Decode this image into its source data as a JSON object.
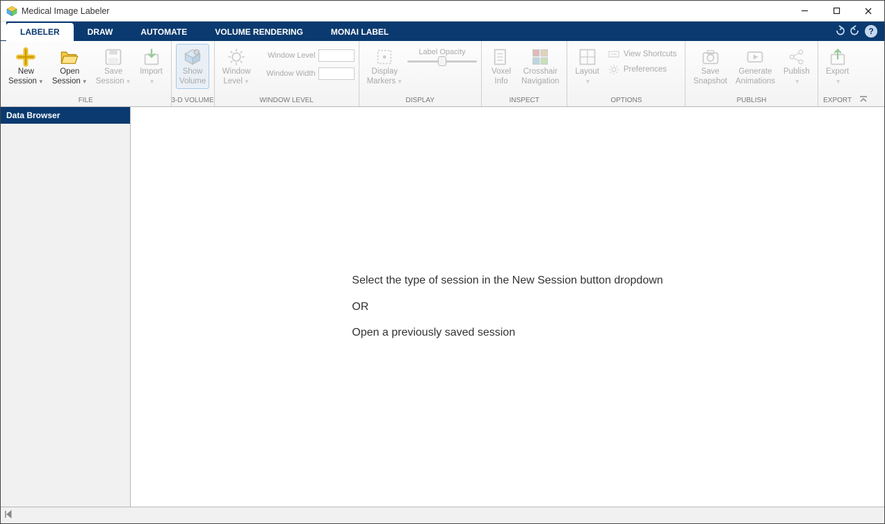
{
  "window_title": "Medical Image Labeler",
  "tabs": [
    {
      "label": "LABELER",
      "active": true
    },
    {
      "label": "DRAW",
      "active": false
    },
    {
      "label": "AUTOMATE",
      "active": false
    },
    {
      "label": "VOLUME RENDERING",
      "active": false
    },
    {
      "label": "MONAI LABEL",
      "active": false
    }
  ],
  "ribbon_groups": {
    "file": {
      "label": "FILE",
      "new_session": "New\nSession",
      "open_session": "Open\nSession",
      "save_session": "Save\nSession",
      "import": "Import"
    },
    "volume3d": {
      "label": "3-D VOLUME",
      "show_volume": "Show\nVolume"
    },
    "window_level": {
      "label": "WINDOW LEVEL",
      "window_level_btn": "Window\nLevel",
      "field_level": "Window Level",
      "field_width": "Window Width"
    },
    "display": {
      "label": "DISPLAY",
      "display_markers": "Display\nMarkers",
      "label_opacity": "Label Opacity"
    },
    "inspect": {
      "label": "INSPECT",
      "voxel_info": "Voxel\nInfo",
      "crosshair_nav": "Crosshair\nNavigation"
    },
    "options": {
      "label": "OPTIONS",
      "layout": "Layout",
      "view_shortcuts": "View Shortcuts",
      "preferences": "Preferences"
    },
    "publish": {
      "label": "PUBLISH",
      "save_snapshot": "Save\nSnapshot",
      "generate_animations": "Generate\nAnimations",
      "publish": "Publish"
    },
    "export": {
      "label": "EXPORT",
      "export": "Export"
    }
  },
  "sidebar": {
    "title": "Data Browser"
  },
  "viewport": {
    "line1": "Select the type of session in the New Session button dropdown",
    "line2": "OR",
    "line3": "Open a previously saved session"
  }
}
